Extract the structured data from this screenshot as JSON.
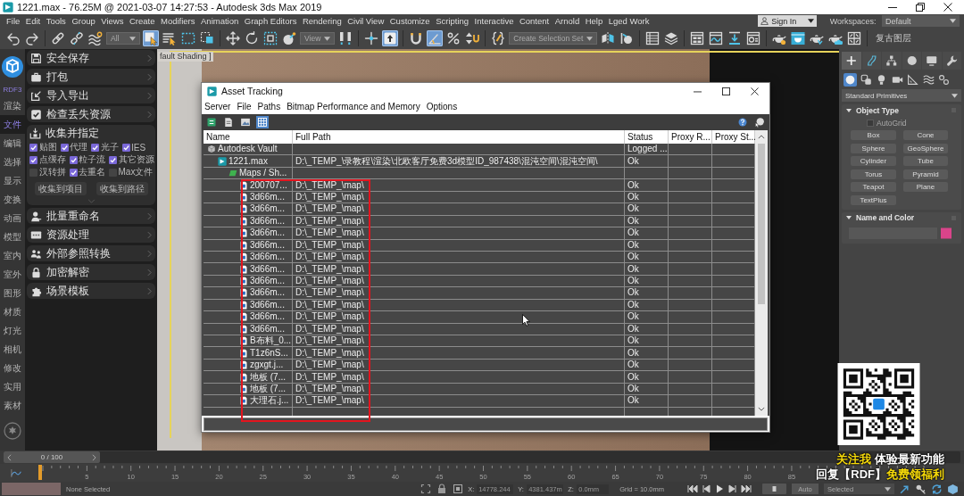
{
  "window": {
    "title": "1221.max - 76.25M @ 2021-03-07 14:27:53 - Autodesk 3ds Max 2019"
  },
  "menu_bar": {
    "items": [
      "File",
      "Edit",
      "Tools",
      "Group",
      "Views",
      "Create",
      "Modifiers",
      "Animation",
      "Graph Editors",
      "Rendering",
      "Civil View",
      "Customize",
      "Scripting",
      "Interactive",
      "Content",
      "Arnold",
      "Help",
      "Lged Work"
    ],
    "sign_in": "Sign In",
    "workspaces_label": "Workspaces:",
    "workspace": "Default"
  },
  "main_toolbar": [
    [
      {
        "kind": "button",
        "selected": false
      },
      {
        "kind": "button",
        "selected": false
      }
    ],
    [
      {
        "kind": "button",
        "selected": false
      },
      {
        "kind": "button",
        "selected": false
      },
      {
        "kind": "button",
        "selected": false
      },
      {
        "kind": "dropdown",
        "value": "All"
      },
      {
        "kind": "button",
        "selected": true
      },
      {
        "kind": "button",
        "selected": false
      },
      {
        "kind": "button",
        "selected": false
      },
      {
        "kind": "button",
        "selected": false
      }
    ],
    [
      {
        "kind": "button",
        "selected": false
      },
      {
        "kind": "button",
        "selected": false
      },
      {
        "kind": "button",
        "selected": false
      },
      {
        "kind": "button",
        "selected": false
      },
      {
        "kind": "dropdown",
        "value": "View"
      },
      {
        "kind": "button",
        "selected": false
      }
    ],
    [
      {
        "kind": "button",
        "selected": false
      },
      {
        "kind": "button",
        "selected": true
      }
    ],
    [
      {
        "kind": "button",
        "selected": false
      },
      {
        "kind": "button",
        "selected": true
      },
      {
        "kind": "button",
        "selected": false
      },
      {
        "kind": "button",
        "selected": false
      }
    ],
    [
      {
        "kind": "button",
        "selected": false
      },
      {
        "kind": "dropdown",
        "value": "Create Selection Set"
      },
      {
        "kind": "button",
        "selected": false
      },
      {
        "kind": "button",
        "selected": false
      }
    ],
    [
      {
        "kind": "button",
        "selected": false
      },
      {
        "kind": "button",
        "selected": false
      }
    ],
    [
      {
        "kind": "button",
        "selected": false
      },
      {
        "kind": "button",
        "selected": false
      },
      {
        "kind": "button",
        "selected": false
      },
      {
        "kind": "button",
        "selected": false
      }
    ],
    [
      {
        "kind": "button",
        "selected": false
      },
      {
        "kind": "button",
        "selected": false
      },
      {
        "kind": "button",
        "selected": false
      },
      {
        "kind": "button",
        "selected": false
      },
      {
        "kind": "button",
        "selected": false
      }
    ],
    [
      {
        "kind": "label",
        "text": "复古图层"
      }
    ]
  ],
  "rdf_panel": {
    "brand": "RDF3",
    "categories": [
      {
        "label": "渲染",
        "selected": false
      },
      {
        "label": "文件",
        "selected": true
      },
      {
        "label": "编辑",
        "selected": false
      },
      {
        "label": "选择",
        "selected": false
      },
      {
        "label": "显示",
        "selected": false
      },
      {
        "label": "变换",
        "selected": false
      },
      {
        "label": "动画",
        "selected": false
      },
      {
        "label": "模型",
        "selected": false
      },
      {
        "label": "室内",
        "selected": false
      },
      {
        "label": "室外",
        "selected": false
      },
      {
        "label": "图形",
        "selected": false
      },
      {
        "label": "材质",
        "selected": false
      },
      {
        "label": "灯光",
        "selected": false
      },
      {
        "label": "相机",
        "selected": false
      },
      {
        "label": "修改",
        "selected": false
      },
      {
        "label": "实用",
        "selected": false
      },
      {
        "label": "素材",
        "selected": false
      }
    ],
    "tools": [
      {
        "label": "安全保存",
        "expanded": false
      },
      {
        "label": "打包",
        "expanded": false
      },
      {
        "label": "导入导出",
        "expanded": false
      },
      {
        "label": "检查丢失资源",
        "expanded": false
      },
      {
        "label": "收集并指定",
        "expanded": true,
        "option_rows": [
          [
            {
              "label": "贴图",
              "checked": true
            },
            {
              "label": "代理",
              "checked": true
            },
            {
              "label": "光子",
              "checked": true
            },
            {
              "label": "IES",
              "checked": true
            }
          ],
          [
            {
              "label": "点缓存",
              "checked": true
            },
            {
              "label": "粒子流",
              "checked": true
            },
            {
              "label": "其它资源",
              "checked": true
            }
          ],
          [
            {
              "label": "汉转拼",
              "checked": false
            },
            {
              "label": "去重名",
              "checked": true
            },
            {
              "label": "Max文件",
              "checked": false
            }
          ]
        ],
        "buttons": [
          "收集到项目",
          "收集到路径"
        ]
      },
      {
        "label": "批量重命名",
        "expanded": false
      },
      {
        "label": "资源处理",
        "expanded": false
      },
      {
        "label": "外部参照转换",
        "expanded": false
      },
      {
        "label": "加密解密",
        "expanded": false
      },
      {
        "label": "场景模板",
        "expanded": false
      }
    ]
  },
  "viewport": {
    "label": "fault Shading ]"
  },
  "asset_tracking": {
    "title": "Asset Tracking",
    "menu": [
      "Server",
      "File",
      "Paths",
      "Bitmap Performance and Memory",
      "Options"
    ],
    "toolbar": [
      {
        "selected": false
      },
      {
        "selected": false
      },
      {
        "selected": false
      },
      {
        "selected": true
      }
    ],
    "columns": [
      "Name",
      "Full Path",
      "Status",
      "Proxy R...",
      "Proxy St..."
    ],
    "rows": [
      {
        "kind": "vault",
        "name": "Autodesk Vault",
        "status": "Logged ...",
        "children": [
          {
            "kind": "scene",
            "name": "1221.max",
            "path": "D:\\_TEMP_\\录教程\\渲染\\北欧客厅免费3d模型ID_987438\\混沌空间\\混沌空间\\",
            "status": "Ok",
            "children": [
              {
                "kind": "folder",
                "name": "Maps / Sh...",
                "children": [
                  {
                    "kind": "bitmap",
                    "name": "200707...",
                    "path": "D:\\_TEMP_\\map\\",
                    "status": "Ok"
                  },
                  {
                    "kind": "bitmap",
                    "name": "3d66m...",
                    "path": "D:\\_TEMP_\\map\\",
                    "status": "Ok"
                  },
                  {
                    "kind": "bitmap",
                    "name": "3d66m...",
                    "path": "D:\\_TEMP_\\map\\",
                    "status": "Ok"
                  },
                  {
                    "kind": "bitmap",
                    "name": "3d66m...",
                    "path": "D:\\_TEMP_\\map\\",
                    "status": "Ok"
                  },
                  {
                    "kind": "bitmap",
                    "name": "3d66m...",
                    "path": "D:\\_TEMP_\\map\\",
                    "status": "Ok"
                  },
                  {
                    "kind": "bitmap",
                    "name": "3d66m...",
                    "path": "D:\\_TEMP_\\map\\",
                    "status": "Ok"
                  },
                  {
                    "kind": "bitmap",
                    "name": "3d66m...",
                    "path": "D:\\_TEMP_\\map\\",
                    "status": "Ok"
                  },
                  {
                    "kind": "bitmap",
                    "name": "3d66m...",
                    "path": "D:\\_TEMP_\\map\\",
                    "status": "Ok"
                  },
                  {
                    "kind": "bitmap",
                    "name": "3d66m...",
                    "path": "D:\\_TEMP_\\map\\",
                    "status": "Ok"
                  },
                  {
                    "kind": "bitmap",
                    "name": "3d66m...",
                    "path": "D:\\_TEMP_\\map\\",
                    "status": "Ok"
                  },
                  {
                    "kind": "bitmap",
                    "name": "3d66m...",
                    "path": "D:\\_TEMP_\\map\\",
                    "status": "Ok"
                  },
                  {
                    "kind": "bitmap",
                    "name": "3d66m...",
                    "path": "D:\\_TEMP_\\map\\",
                    "status": "Ok"
                  },
                  {
                    "kind": "bitmap",
                    "name": "3d66m...",
                    "path": "D:\\_TEMP_\\map\\",
                    "status": "Ok"
                  },
                  {
                    "kind": "bitmap",
                    "name": "B布料_0...",
                    "path": "D:\\_TEMP_\\map\\",
                    "status": "Ok"
                  },
                  {
                    "kind": "bitmap",
                    "name": "T1z6nS...",
                    "path": "D:\\_TEMP_\\map\\",
                    "status": "Ok"
                  },
                  {
                    "kind": "bitmap",
                    "name": "zgxgt.j...",
                    "path": "D:\\_TEMP_\\map\\",
                    "status": "Ok"
                  },
                  {
                    "kind": "bitmap",
                    "name": "地板 (7...",
                    "path": "D:\\_TEMP_\\map\\",
                    "status": "Ok"
                  },
                  {
                    "kind": "bitmap",
                    "name": "地板 (7...",
                    "path": "D:\\_TEMP_\\map\\",
                    "status": "Ok"
                  },
                  {
                    "kind": "bitmap",
                    "name": "大理石.j...",
                    "path": "D:\\_TEMP_\\map\\",
                    "status": "Ok"
                  }
                ]
              }
            ]
          }
        ]
      }
    ]
  },
  "command_panel": {
    "tabs": [
      {
        "selected": true
      },
      {
        "selected": false
      },
      {
        "selected": false
      },
      {
        "selected": false
      },
      {
        "selected": false
      },
      {
        "selected": false
      }
    ],
    "subcategories": [
      {
        "selected": true
      },
      {
        "selected": false
      },
      {
        "selected": false
      },
      {
        "selected": false
      },
      {
        "selected": false
      },
      {
        "selected": false
      },
      {
        "selected": false
      }
    ],
    "category": "Standard Primitives",
    "rollouts": [
      {
        "kind": "object_type",
        "title": "Object Type",
        "expanded": true,
        "autogrid": {
          "label": "AutoGrid",
          "checked": false,
          "disabled": true
        },
        "buttons": [
          "Box",
          "Cone",
          "Sphere",
          "GeoSphere",
          "Cylinder",
          "Tube",
          "Torus",
          "Pyramid",
          "Teapot",
          "Plane",
          "TextPlus"
        ]
      },
      {
        "kind": "name_color",
        "title": "Name and Color",
        "expanded": true,
        "color": "#d9448a"
      }
    ]
  },
  "time_slider": {
    "label": "0 / 100",
    "level": 0
  },
  "track_bar": {
    "labels": [
      "5",
      "10",
      "15",
      "20",
      "25",
      "30",
      "35",
      "40",
      "45",
      "50",
      "55",
      "60",
      "65",
      "70",
      "75",
      "80",
      "85"
    ]
  },
  "status_bar": {
    "selection": "None Selected",
    "coordinates": [
      {
        "axis": "X:",
        "value": "14778.244"
      },
      {
        "axis": "Y:",
        "value": "4381.437m"
      },
      {
        "axis": "Z:",
        "value": "0.0mm"
      }
    ],
    "grid": "Grid = 10.0mm",
    "key_mode": "Auto",
    "key_filter": "Selected"
  },
  "promo": {
    "lines": [
      [
        {
          "text": "关注我",
          "highlight": true
        },
        {
          "text": " 体验最新功能",
          "highlight": false
        }
      ],
      [
        {
          "text": "回复【RDF】",
          "highlight": false
        },
        {
          "text": "免费领福利",
          "highlight": true
        }
      ]
    ]
  }
}
